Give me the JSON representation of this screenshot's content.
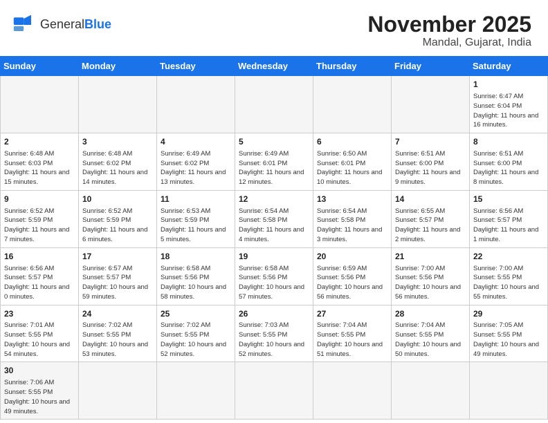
{
  "header": {
    "logo_general": "General",
    "logo_blue": "Blue",
    "month": "November 2025",
    "location": "Mandal, Gujarat, India"
  },
  "weekdays": [
    "Sunday",
    "Monday",
    "Tuesday",
    "Wednesday",
    "Thursday",
    "Friday",
    "Saturday"
  ],
  "days": [
    {
      "num": "",
      "sunrise": "",
      "sunset": "",
      "daylight": "",
      "empty": true
    },
    {
      "num": "",
      "sunrise": "",
      "sunset": "",
      "daylight": "",
      "empty": true
    },
    {
      "num": "",
      "sunrise": "",
      "sunset": "",
      "daylight": "",
      "empty": true
    },
    {
      "num": "",
      "sunrise": "",
      "sunset": "",
      "daylight": "",
      "empty": true
    },
    {
      "num": "",
      "sunrise": "",
      "sunset": "",
      "daylight": "",
      "empty": true
    },
    {
      "num": "",
      "sunrise": "",
      "sunset": "",
      "daylight": "",
      "empty": true
    },
    {
      "num": "1",
      "sunrise": "Sunrise: 6:47 AM",
      "sunset": "Sunset: 6:04 PM",
      "daylight": "Daylight: 11 hours and 16 minutes.",
      "empty": false
    },
    {
      "num": "2",
      "sunrise": "Sunrise: 6:48 AM",
      "sunset": "Sunset: 6:03 PM",
      "daylight": "Daylight: 11 hours and 15 minutes.",
      "empty": false
    },
    {
      "num": "3",
      "sunrise": "Sunrise: 6:48 AM",
      "sunset": "Sunset: 6:02 PM",
      "daylight": "Daylight: 11 hours and 14 minutes.",
      "empty": false
    },
    {
      "num": "4",
      "sunrise": "Sunrise: 6:49 AM",
      "sunset": "Sunset: 6:02 PM",
      "daylight": "Daylight: 11 hours and 13 minutes.",
      "empty": false
    },
    {
      "num": "5",
      "sunrise": "Sunrise: 6:49 AM",
      "sunset": "Sunset: 6:01 PM",
      "daylight": "Daylight: 11 hours and 12 minutes.",
      "empty": false
    },
    {
      "num": "6",
      "sunrise": "Sunrise: 6:50 AM",
      "sunset": "Sunset: 6:01 PM",
      "daylight": "Daylight: 11 hours and 10 minutes.",
      "empty": false
    },
    {
      "num": "7",
      "sunrise": "Sunrise: 6:51 AM",
      "sunset": "Sunset: 6:00 PM",
      "daylight": "Daylight: 11 hours and 9 minutes.",
      "empty": false
    },
    {
      "num": "8",
      "sunrise": "Sunrise: 6:51 AM",
      "sunset": "Sunset: 6:00 PM",
      "daylight": "Daylight: 11 hours and 8 minutes.",
      "empty": false
    },
    {
      "num": "9",
      "sunrise": "Sunrise: 6:52 AM",
      "sunset": "Sunset: 5:59 PM",
      "daylight": "Daylight: 11 hours and 7 minutes.",
      "empty": false
    },
    {
      "num": "10",
      "sunrise": "Sunrise: 6:52 AM",
      "sunset": "Sunset: 5:59 PM",
      "daylight": "Daylight: 11 hours and 6 minutes.",
      "empty": false
    },
    {
      "num": "11",
      "sunrise": "Sunrise: 6:53 AM",
      "sunset": "Sunset: 5:59 PM",
      "daylight": "Daylight: 11 hours and 5 minutes.",
      "empty": false
    },
    {
      "num": "12",
      "sunrise": "Sunrise: 6:54 AM",
      "sunset": "Sunset: 5:58 PM",
      "daylight": "Daylight: 11 hours and 4 minutes.",
      "empty": false
    },
    {
      "num": "13",
      "sunrise": "Sunrise: 6:54 AM",
      "sunset": "Sunset: 5:58 PM",
      "daylight": "Daylight: 11 hours and 3 minutes.",
      "empty": false
    },
    {
      "num": "14",
      "sunrise": "Sunrise: 6:55 AM",
      "sunset": "Sunset: 5:57 PM",
      "daylight": "Daylight: 11 hours and 2 minutes.",
      "empty": false
    },
    {
      "num": "15",
      "sunrise": "Sunrise: 6:56 AM",
      "sunset": "Sunset: 5:57 PM",
      "daylight": "Daylight: 11 hours and 1 minute.",
      "empty": false
    },
    {
      "num": "16",
      "sunrise": "Sunrise: 6:56 AM",
      "sunset": "Sunset: 5:57 PM",
      "daylight": "Daylight: 11 hours and 0 minutes.",
      "empty": false
    },
    {
      "num": "17",
      "sunrise": "Sunrise: 6:57 AM",
      "sunset": "Sunset: 5:57 PM",
      "daylight": "Daylight: 10 hours and 59 minutes.",
      "empty": false
    },
    {
      "num": "18",
      "sunrise": "Sunrise: 6:58 AM",
      "sunset": "Sunset: 5:56 PM",
      "daylight": "Daylight: 10 hours and 58 minutes.",
      "empty": false
    },
    {
      "num": "19",
      "sunrise": "Sunrise: 6:58 AM",
      "sunset": "Sunset: 5:56 PM",
      "daylight": "Daylight: 10 hours and 57 minutes.",
      "empty": false
    },
    {
      "num": "20",
      "sunrise": "Sunrise: 6:59 AM",
      "sunset": "Sunset: 5:56 PM",
      "daylight": "Daylight: 10 hours and 56 minutes.",
      "empty": false
    },
    {
      "num": "21",
      "sunrise": "Sunrise: 7:00 AM",
      "sunset": "Sunset: 5:56 PM",
      "daylight": "Daylight: 10 hours and 56 minutes.",
      "empty": false
    },
    {
      "num": "22",
      "sunrise": "Sunrise: 7:00 AM",
      "sunset": "Sunset: 5:55 PM",
      "daylight": "Daylight: 10 hours and 55 minutes.",
      "empty": false
    },
    {
      "num": "23",
      "sunrise": "Sunrise: 7:01 AM",
      "sunset": "Sunset: 5:55 PM",
      "daylight": "Daylight: 10 hours and 54 minutes.",
      "empty": false
    },
    {
      "num": "24",
      "sunrise": "Sunrise: 7:02 AM",
      "sunset": "Sunset: 5:55 PM",
      "daylight": "Daylight: 10 hours and 53 minutes.",
      "empty": false
    },
    {
      "num": "25",
      "sunrise": "Sunrise: 7:02 AM",
      "sunset": "Sunset: 5:55 PM",
      "daylight": "Daylight: 10 hours and 52 minutes.",
      "empty": false
    },
    {
      "num": "26",
      "sunrise": "Sunrise: 7:03 AM",
      "sunset": "Sunset: 5:55 PM",
      "daylight": "Daylight: 10 hours and 52 minutes.",
      "empty": false
    },
    {
      "num": "27",
      "sunrise": "Sunrise: 7:04 AM",
      "sunset": "Sunset: 5:55 PM",
      "daylight": "Daylight: 10 hours and 51 minutes.",
      "empty": false
    },
    {
      "num": "28",
      "sunrise": "Sunrise: 7:04 AM",
      "sunset": "Sunset: 5:55 PM",
      "daylight": "Daylight: 10 hours and 50 minutes.",
      "empty": false
    },
    {
      "num": "29",
      "sunrise": "Sunrise: 7:05 AM",
      "sunset": "Sunset: 5:55 PM",
      "daylight": "Daylight: 10 hours and 49 minutes.",
      "empty": false
    },
    {
      "num": "30",
      "sunrise": "Sunrise: 7:06 AM",
      "sunset": "Sunset: 5:55 PM",
      "daylight": "Daylight: 10 hours and 49 minutes.",
      "empty": false
    }
  ]
}
